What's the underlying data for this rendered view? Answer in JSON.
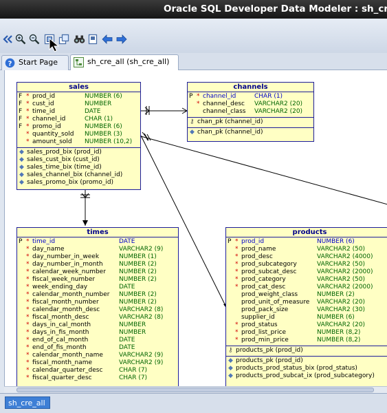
{
  "window": {
    "title": "Oracle SQL Developer Data Modeler : sh_cre_all"
  },
  "toolbar": {
    "icons": [
      "chevron-double-left-icon",
      "zoom-in-icon",
      "zoom-out-icon",
      "fit-screen-icon",
      "restore-icon",
      "binoculars-icon",
      "page-icon",
      "back-arrow-icon",
      "forward-arrow-icon"
    ]
  },
  "tabs": [
    {
      "label": "Start Page"
    },
    {
      "label": "sh_cre_all (sh_cre_all)"
    }
  ],
  "bottom": {
    "tab": "sh_cre_all"
  },
  "tables": {
    "sales": {
      "title": "sales",
      "columns": [
        {
          "k": "F",
          "m": "*",
          "n": "prod_id",
          "t": "NUMBER (6)"
        },
        {
          "k": "F",
          "m": "*",
          "n": "cust_id",
          "t": "NUMBER"
        },
        {
          "k": "F",
          "m": "*",
          "n": "time_id",
          "t": "DATE"
        },
        {
          "k": "F",
          "m": "*",
          "n": "channel_id",
          "t": "CHAR (1)"
        },
        {
          "k": "F",
          "m": "*",
          "n": "promo_id",
          "t": "NUMBER (6)"
        },
        {
          "k": "",
          "m": "*",
          "n": "quantity_sold",
          "t": "NUMBER (3)"
        },
        {
          "k": "",
          "m": "*",
          "n": "amount_sold",
          "t": "NUMBER (10,2)"
        }
      ],
      "keys": [],
      "indexes": [
        "sales_prod_bix (prod_id)",
        "sales_cust_bix (cust_id)",
        "sales_time_bix (time_id)",
        "sales_channel_bix (channel_id)",
        "sales_promo_bix (promo_id)"
      ]
    },
    "channels": {
      "title": "channels",
      "columns": [
        {
          "k": "P",
          "m": "*",
          "n": "channel_id",
          "t": "CHAR (1)"
        },
        {
          "k": "",
          "m": "*",
          "n": "channel_desc",
          "t": "VARCHAR2 (20)"
        },
        {
          "k": "",
          "m": "",
          "n": "channel_class",
          "t": "VARCHAR2 (20)"
        }
      ],
      "keys": [
        "chan_pk (channel_id)"
      ],
      "indexes": [
        "chan_pk (channel_id)"
      ]
    },
    "times": {
      "title": "times",
      "columns": [
        {
          "k": "P",
          "m": "*",
          "n": "time_id",
          "t": "DATE"
        },
        {
          "k": "",
          "m": "*",
          "n": "day_name",
          "t": "VARCHAR2 (9)"
        },
        {
          "k": "",
          "m": "*",
          "n": "day_number_in_week",
          "t": "NUMBER (1)"
        },
        {
          "k": "",
          "m": "*",
          "n": "day_number_in_month",
          "t": "NUMBER (2)"
        },
        {
          "k": "",
          "m": "*",
          "n": "calendar_week_number",
          "t": "NUMBER (2)"
        },
        {
          "k": "",
          "m": "*",
          "n": "fiscal_week_number",
          "t": "NUMBER (2)"
        },
        {
          "k": "",
          "m": "*",
          "n": "week_ending_day",
          "t": "DATE"
        },
        {
          "k": "",
          "m": "*",
          "n": "calendar_month_number",
          "t": "NUMBER (2)"
        },
        {
          "k": "",
          "m": "*",
          "n": "fiscal_month_number",
          "t": "NUMBER (2)"
        },
        {
          "k": "",
          "m": "*",
          "n": "calendar_month_desc",
          "t": "VARCHAR2 (8)"
        },
        {
          "k": "",
          "m": "*",
          "n": "fiscal_month_desc",
          "t": "VARCHAR2 (8)"
        },
        {
          "k": "",
          "m": "*",
          "n": "days_in_cal_month",
          "t": "NUMBER"
        },
        {
          "k": "",
          "m": "*",
          "n": "days_in_fis_month",
          "t": "NUMBER"
        },
        {
          "k": "",
          "m": "*",
          "n": "end_of_cal_month",
          "t": "DATE"
        },
        {
          "k": "",
          "m": "*",
          "n": "end_of_fis_month",
          "t": "DATE"
        },
        {
          "k": "",
          "m": "*",
          "n": "calendar_month_name",
          "t": "VARCHAR2 (9)"
        },
        {
          "k": "",
          "m": "*",
          "n": "fiscal_month_name",
          "t": "VARCHAR2 (9)"
        },
        {
          "k": "",
          "m": "*",
          "n": "calendar_quarter_desc",
          "t": "CHAR (7)"
        },
        {
          "k": "",
          "m": "*",
          "n": "fiscal_quarter_desc",
          "t": "CHAR (7)"
        }
      ],
      "keys": [],
      "indexes": []
    },
    "products": {
      "title": "products",
      "columns": [
        {
          "k": "P",
          "m": "*",
          "n": "prod_id",
          "t": "NUMBER (6)"
        },
        {
          "k": "",
          "m": "*",
          "n": "prod_name",
          "t": "VARCHAR2 (50)"
        },
        {
          "k": "",
          "m": "*",
          "n": "prod_desc",
          "t": "VARCHAR2 (4000)"
        },
        {
          "k": "",
          "m": "*",
          "n": "prod_subcategory",
          "t": "VARCHAR2 (50)"
        },
        {
          "k": "",
          "m": "*",
          "n": "prod_subcat_desc",
          "t": "VARCHAR2 (2000)"
        },
        {
          "k": "",
          "m": "*",
          "n": "prod_category",
          "t": "VARCHAR2 (50)"
        },
        {
          "k": "",
          "m": "*",
          "n": "prod_cat_desc",
          "t": "VARCHAR2 (2000)"
        },
        {
          "k": "",
          "m": "",
          "n": "prod_weight_class",
          "t": "NUMBER (2)"
        },
        {
          "k": "",
          "m": "",
          "n": "prod_unit_of_measure",
          "t": "VARCHAR2 (20)"
        },
        {
          "k": "",
          "m": "",
          "n": "prod_pack_size",
          "t": "VARCHAR2 (30)"
        },
        {
          "k": "",
          "m": "",
          "n": "supplier_id",
          "t": "NUMBER (6)"
        },
        {
          "k": "",
          "m": "*",
          "n": "prod_status",
          "t": "VARCHAR2 (20)"
        },
        {
          "k": "",
          "m": "*",
          "n": "prod_list_price",
          "t": "NUMBER (8,2)"
        },
        {
          "k": "",
          "m": "*",
          "n": "prod_min_price",
          "t": "NUMBER (8,2)"
        }
      ],
      "keys": [
        "products_pk (prod_id)"
      ],
      "indexes": [
        "products_pk (prod_id)",
        "products_prod_status_bix (prod_status)",
        "products_prod_subcat_ix (prod_subcategory)"
      ]
    }
  }
}
